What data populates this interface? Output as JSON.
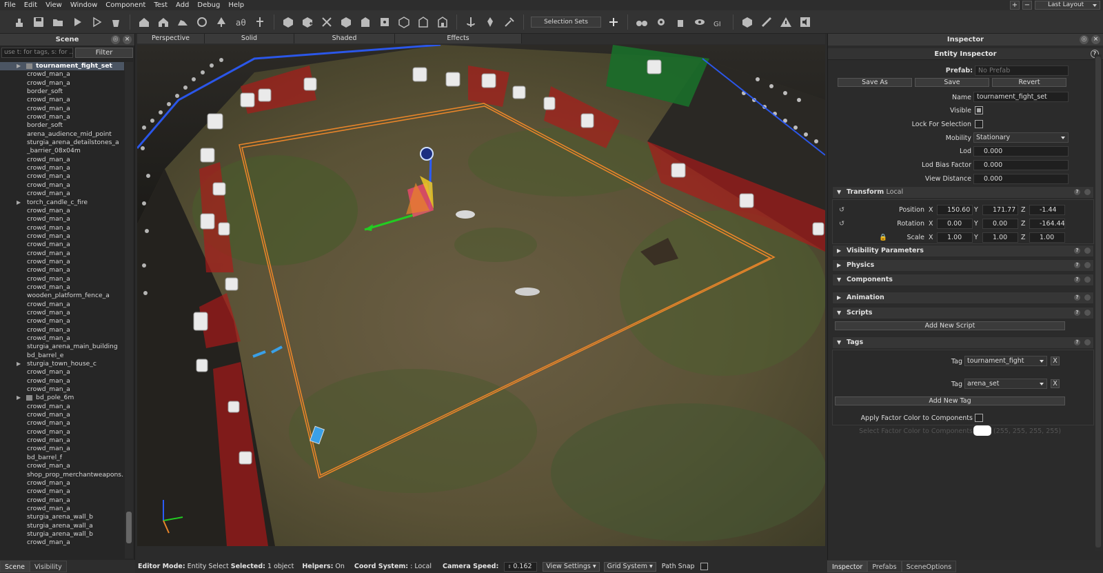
{
  "menu": [
    "File",
    "Edit",
    "View",
    "Window",
    "Component",
    "Test",
    "Add",
    "Debug",
    "Help"
  ],
  "layout": {
    "label": "Last Layout"
  },
  "toolbar": {
    "selection_sets_label": "Selection Sets"
  },
  "scene_panel": {
    "title": "Scene",
    "search_placeholder": "use t: for tags, s: for ...",
    "filter_label": "Filter",
    "items": [
      {
        "label": "tournament_fight_set",
        "expand": true,
        "icon": true,
        "selected": true
      },
      {
        "label": "crowd_man_a"
      },
      {
        "label": "crowd_man_a"
      },
      {
        "label": "border_soft"
      },
      {
        "label": "crowd_man_a"
      },
      {
        "label": "crowd_man_a"
      },
      {
        "label": "crowd_man_a"
      },
      {
        "label": "border_soft"
      },
      {
        "label": "arena_audience_mid_point"
      },
      {
        "label": "sturgia_arena_detailstones_a"
      },
      {
        "label": "_barrier_08x04m"
      },
      {
        "label": "crowd_man_a"
      },
      {
        "label": "crowd_man_a"
      },
      {
        "label": "crowd_man_a"
      },
      {
        "label": "crowd_man_a"
      },
      {
        "label": "crowd_man_a"
      },
      {
        "label": "torch_candle_c_fire",
        "expand": true
      },
      {
        "label": "crowd_man_a"
      },
      {
        "label": "crowd_man_a"
      },
      {
        "label": "crowd_man_a"
      },
      {
        "label": "crowd_man_a"
      },
      {
        "label": "crowd_man_a"
      },
      {
        "label": "crowd_man_a"
      },
      {
        "label": "crowd_man_a"
      },
      {
        "label": "crowd_man_a"
      },
      {
        "label": "crowd_man_a"
      },
      {
        "label": "crowd_man_a"
      },
      {
        "label": "wooden_platform_fence_a"
      },
      {
        "label": "crowd_man_a"
      },
      {
        "label": "crowd_man_a"
      },
      {
        "label": "crowd_man_a"
      },
      {
        "label": "crowd_man_a"
      },
      {
        "label": "crowd_man_a"
      },
      {
        "label": "sturgia_arena_main_building"
      },
      {
        "label": "bd_barrel_e"
      },
      {
        "label": "sturgia_town_house_c",
        "expand": true
      },
      {
        "label": "crowd_man_a"
      },
      {
        "label": "crowd_man_a"
      },
      {
        "label": "crowd_man_a"
      },
      {
        "label": "bd_pole_6m",
        "expand": true,
        "icon": true
      },
      {
        "label": "crowd_man_a"
      },
      {
        "label": "crowd_man_a"
      },
      {
        "label": "crowd_man_a"
      },
      {
        "label": "crowd_man_a"
      },
      {
        "label": "crowd_man_a"
      },
      {
        "label": "crowd_man_a"
      },
      {
        "label": "bd_barrel_f"
      },
      {
        "label": "crowd_man_a"
      },
      {
        "label": "shop_prop_merchantweapons..."
      },
      {
        "label": "crowd_man_a"
      },
      {
        "label": "crowd_man_a"
      },
      {
        "label": "crowd_man_a"
      },
      {
        "label": "crowd_man_a"
      },
      {
        "label": "sturgia_arena_wall_b"
      },
      {
        "label": "sturgia_arena_wall_a"
      },
      {
        "label": "sturgia_arena_wall_b"
      },
      {
        "label": "crowd_man_a"
      }
    ],
    "bottom_tabs": [
      "Scene",
      "Visibility"
    ]
  },
  "viewport": {
    "tabs": [
      "Perspective",
      "Solid",
      "Shaded",
      "Effects"
    ]
  },
  "status": {
    "editor_mode_label": "Editor Mode:",
    "editor_mode_value": "Entity Select",
    "selected_label": "Selected:",
    "selected_value": "1 object",
    "helpers_label": "Helpers:",
    "helpers_value": "On",
    "coord_label": "Coord System:",
    "coord_value": ": Local",
    "camera_speed_label": "Camera Speed:",
    "camera_speed_value": "0.162",
    "view_settings": "View Settings",
    "grid_system": "Grid System",
    "path_snap": "Path Snap"
  },
  "inspector": {
    "title": "Inspector",
    "subtitle": "Entity Inspector",
    "prefab_label": "Prefab:",
    "prefab_placeholder": "No Prefab",
    "save_as": "Save As",
    "save": "Save",
    "revert": "Revert",
    "name_label": "Name",
    "name_value": "tournament_fight_set",
    "visible_label": "Visible",
    "lock_label": "Lock For Selection",
    "mobility_label": "Mobility",
    "mobility_value": "Stationary",
    "lod_label": "Lod",
    "lod_value": "0.000",
    "lod_bias_label": "Lod Bias Factor",
    "lod_bias_value": "0.000",
    "view_dist_label": "View Distance",
    "view_dist_value": "0.000",
    "transform": {
      "title": "Transform",
      "local": "Local",
      "position_label": "Position",
      "rotation_label": "Rotation",
      "scale_label": "Scale",
      "axis_x": "X",
      "axis_y": "Y",
      "axis_z": "Z",
      "position": [
        "150.60",
        "171.77",
        "-1.44"
      ],
      "rotation": [
        "0.00",
        "0.00",
        "-164.44"
      ],
      "scale": [
        "1.00",
        "1.00",
        "1.00"
      ]
    },
    "sections": {
      "visibility": "Visibility Parameters",
      "physics": "Physics",
      "components": "Components",
      "animation": "Animation",
      "scripts": "Scripts",
      "tags": "Tags"
    },
    "add_script": "Add New Script",
    "tag_label": "Tag",
    "tags": [
      "tournament_fight",
      "arena_set"
    ],
    "remove_tag": "X",
    "add_tag": "Add New Tag",
    "apply_factor_label": "Apply Factor Color to Components",
    "select_factor_label": "Select Factor Color to Components",
    "factor_color_value": "(255, 255, 255, 255)",
    "bottom_tabs": [
      "Inspector",
      "Prefabs",
      "SceneOptions"
    ]
  },
  "colors": {
    "accent_orange": "#e8852a",
    "marker_red": "#b01818",
    "gizmo_blue": "#2b5cff",
    "gizmo_green": "#22cc22"
  }
}
